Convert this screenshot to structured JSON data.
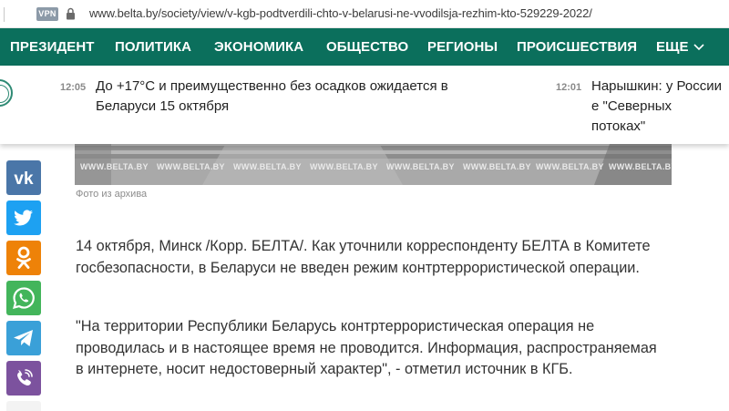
{
  "address_bar": {
    "vpn_badge": "VPN",
    "url": "www.belta.by/society/view/v-kgb-podtverdili-chto-v-belarusi-ne-vvodilsja-rezhim-kto-529229-2022/",
    "lock_icon": "lock-icon"
  },
  "menu": {
    "items": [
      "ПРЕЗИДЕНТ",
      "ПОЛИТИКА",
      "ЭКОНОМИКА",
      "ОБЩЕСТВО",
      "РЕГИОНЫ",
      "ПРОИСШЕСТВИЯ",
      "ЕЩЕ"
    ],
    "more_icon": "chevron-down-icon",
    "background": "#0b6f5c"
  },
  "ticker": [
    {
      "time": "12:05",
      "title": "До +17°С и преимущественно без осадков ожидается в Беларуси 15 октября"
    },
    {
      "time": "12:01",
      "title": "Нарышкин: у России е \"Северных потоках\""
    }
  ],
  "photo": {
    "watermark": "WWW.BELTA.BY",
    "caption": "Фото из архива"
  },
  "social": [
    {
      "name": "vk",
      "icon": "vk-icon",
      "color": "#4a76a8"
    },
    {
      "name": "twitter",
      "icon": "twitter-icon",
      "color": "#1da1f2"
    },
    {
      "name": "odnoklassniki",
      "icon": "odnoklassniki-icon",
      "color": "#ee8208"
    },
    {
      "name": "whatsapp",
      "icon": "whatsapp-icon",
      "color": "#43b55b"
    },
    {
      "name": "telegram",
      "icon": "telegram-icon",
      "color": "#3aa0d8"
    },
    {
      "name": "viber",
      "icon": "viber-icon",
      "color": "#7c529e"
    }
  ],
  "article": {
    "paragraphs": [
      "14 октября, Минск /Корр. БЕЛТА/. Как уточнили корреспонденту БЕЛТА в Комитете госбезопасности, в Беларуси не введен режим контртеррористической операции.",
      "\"На территории Республики Беларусь контртеррористическая операция не проводилась и в настоящее время не проводится. Информация, распространяемая в интернете, носит недостоверный характер\", - отметил источник в КГБ."
    ]
  }
}
